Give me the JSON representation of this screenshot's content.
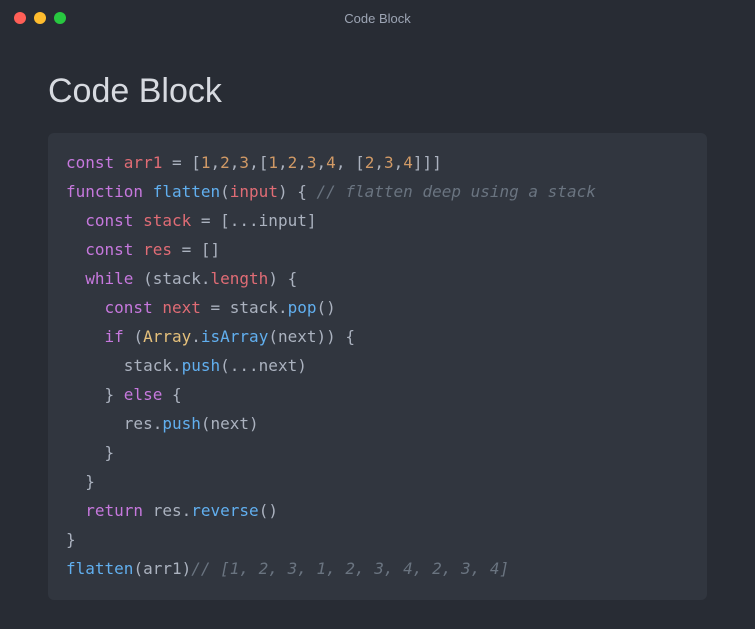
{
  "window": {
    "title": "Code Block"
  },
  "page": {
    "heading": "Code Block"
  },
  "code": {
    "lines": [
      [
        {
          "t": "const ",
          "c": "kw"
        },
        {
          "t": "arr1",
          "c": "def"
        },
        {
          "t": " = [",
          "c": "punc"
        },
        {
          "t": "1",
          "c": "num"
        },
        {
          "t": ",",
          "c": "punc"
        },
        {
          "t": "2",
          "c": "num"
        },
        {
          "t": ",",
          "c": "punc"
        },
        {
          "t": "3",
          "c": "num"
        },
        {
          "t": ",[",
          "c": "punc"
        },
        {
          "t": "1",
          "c": "num"
        },
        {
          "t": ",",
          "c": "punc"
        },
        {
          "t": "2",
          "c": "num"
        },
        {
          "t": ",",
          "c": "punc"
        },
        {
          "t": "3",
          "c": "num"
        },
        {
          "t": ",",
          "c": "punc"
        },
        {
          "t": "4",
          "c": "num"
        },
        {
          "t": ", [",
          "c": "punc"
        },
        {
          "t": "2",
          "c": "num"
        },
        {
          "t": ",",
          "c": "punc"
        },
        {
          "t": "3",
          "c": "num"
        },
        {
          "t": ",",
          "c": "punc"
        },
        {
          "t": "4",
          "c": "num"
        },
        {
          "t": "]]]",
          "c": "punc"
        }
      ],
      [
        {
          "t": "function ",
          "c": "kw"
        },
        {
          "t": "flatten",
          "c": "fn"
        },
        {
          "t": "(",
          "c": "punc"
        },
        {
          "t": "input",
          "c": "def"
        },
        {
          "t": ") { ",
          "c": "punc"
        },
        {
          "t": "// flatten deep using a stack",
          "c": "comment"
        }
      ],
      [
        {
          "t": "  ",
          "c": "punc"
        },
        {
          "t": "const ",
          "c": "kw"
        },
        {
          "t": "stack",
          "c": "def"
        },
        {
          "t": " = [...",
          "c": "punc"
        },
        {
          "t": "input",
          "c": "var"
        },
        {
          "t": "]",
          "c": "punc"
        }
      ],
      [
        {
          "t": "  ",
          "c": "punc"
        },
        {
          "t": "const ",
          "c": "kw"
        },
        {
          "t": "res",
          "c": "def"
        },
        {
          "t": " = []",
          "c": "punc"
        }
      ],
      [
        {
          "t": "  ",
          "c": "punc"
        },
        {
          "t": "while ",
          "c": "kw"
        },
        {
          "t": "(",
          "c": "punc"
        },
        {
          "t": "stack",
          "c": "var"
        },
        {
          "t": ".",
          "c": "punc"
        },
        {
          "t": "length",
          "c": "def"
        },
        {
          "t": ") {",
          "c": "punc"
        }
      ],
      [
        {
          "t": "    ",
          "c": "punc"
        },
        {
          "t": "const ",
          "c": "kw"
        },
        {
          "t": "next",
          "c": "def"
        },
        {
          "t": " = ",
          "c": "punc"
        },
        {
          "t": "stack",
          "c": "var"
        },
        {
          "t": ".",
          "c": "punc"
        },
        {
          "t": "pop",
          "c": "fn"
        },
        {
          "t": "()",
          "c": "punc"
        }
      ],
      [
        {
          "t": "    ",
          "c": "punc"
        },
        {
          "t": "if ",
          "c": "kw"
        },
        {
          "t": "(",
          "c": "punc"
        },
        {
          "t": "Array",
          "c": "obj"
        },
        {
          "t": ".",
          "c": "punc"
        },
        {
          "t": "isArray",
          "c": "fn"
        },
        {
          "t": "(",
          "c": "punc"
        },
        {
          "t": "next",
          "c": "var"
        },
        {
          "t": ")) {",
          "c": "punc"
        }
      ],
      [
        {
          "t": "      ",
          "c": "punc"
        },
        {
          "t": "stack",
          "c": "var"
        },
        {
          "t": ".",
          "c": "punc"
        },
        {
          "t": "push",
          "c": "fn"
        },
        {
          "t": "(...",
          "c": "punc"
        },
        {
          "t": "next",
          "c": "var"
        },
        {
          "t": ")",
          "c": "punc"
        }
      ],
      [
        {
          "t": "    } ",
          "c": "punc"
        },
        {
          "t": "else",
          "c": "kw"
        },
        {
          "t": " {",
          "c": "punc"
        }
      ],
      [
        {
          "t": "      ",
          "c": "punc"
        },
        {
          "t": "res",
          "c": "var"
        },
        {
          "t": ".",
          "c": "punc"
        },
        {
          "t": "push",
          "c": "fn"
        },
        {
          "t": "(",
          "c": "punc"
        },
        {
          "t": "next",
          "c": "var"
        },
        {
          "t": ")",
          "c": "punc"
        }
      ],
      [
        {
          "t": "    }",
          "c": "punc"
        }
      ],
      [
        {
          "t": "  }",
          "c": "punc"
        }
      ],
      [
        {
          "t": "  ",
          "c": "punc"
        },
        {
          "t": "return ",
          "c": "kw"
        },
        {
          "t": "res",
          "c": "var"
        },
        {
          "t": ".",
          "c": "punc"
        },
        {
          "t": "reverse",
          "c": "fn"
        },
        {
          "t": "()",
          "c": "punc"
        }
      ],
      [
        {
          "t": "}",
          "c": "punc"
        }
      ],
      [
        {
          "t": "flatten",
          "c": "fn"
        },
        {
          "t": "(",
          "c": "punc"
        },
        {
          "t": "arr1",
          "c": "var"
        },
        {
          "t": ")",
          "c": "punc"
        },
        {
          "t": "// [1, 2, 3, 1, 2, 3, 4, 2, 3, 4]",
          "c": "comment"
        }
      ]
    ]
  }
}
